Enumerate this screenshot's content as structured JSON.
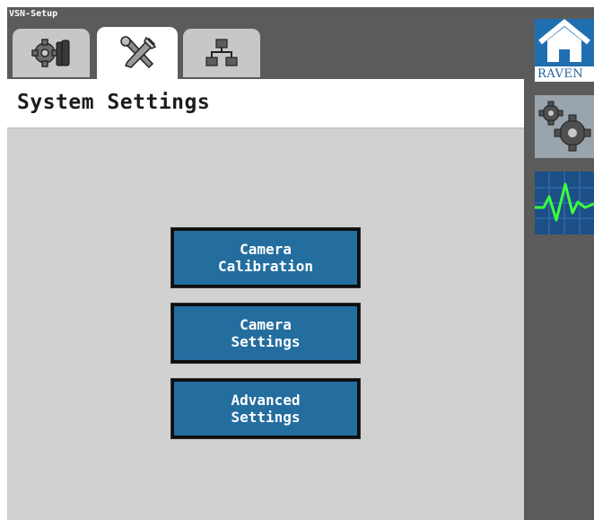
{
  "app": {
    "title": "VSN-Setup"
  },
  "tabs": [
    {
      "name": "tab-diagnostics",
      "icon": "gear-wrench-icon",
      "active": false
    },
    {
      "name": "tab-system-settings",
      "icon": "tools-icon",
      "active": true
    },
    {
      "name": "tab-network",
      "icon": "network-icon",
      "active": false
    }
  ],
  "page": {
    "title": "System Settings"
  },
  "menu": {
    "camera_calibration": {
      "line1": "Camera",
      "line2": "Calibration"
    },
    "camera_settings": {
      "line1": "Camera",
      "line2": "Settings"
    },
    "advanced_settings": {
      "line1": "Advanced",
      "line2": "Settings"
    }
  },
  "sidebar": {
    "home": {
      "icon": "home-icon",
      "brand_label": "RAVEN"
    },
    "settings": {
      "icon": "gears-icon"
    },
    "diagnostics": {
      "icon": "waveform-icon"
    }
  },
  "colors": {
    "button_blue": "#246d9f",
    "sidebar_blue": "#1f6fb0",
    "frame_gray": "#5b5b5b",
    "content_gray": "#d1d1d1"
  }
}
